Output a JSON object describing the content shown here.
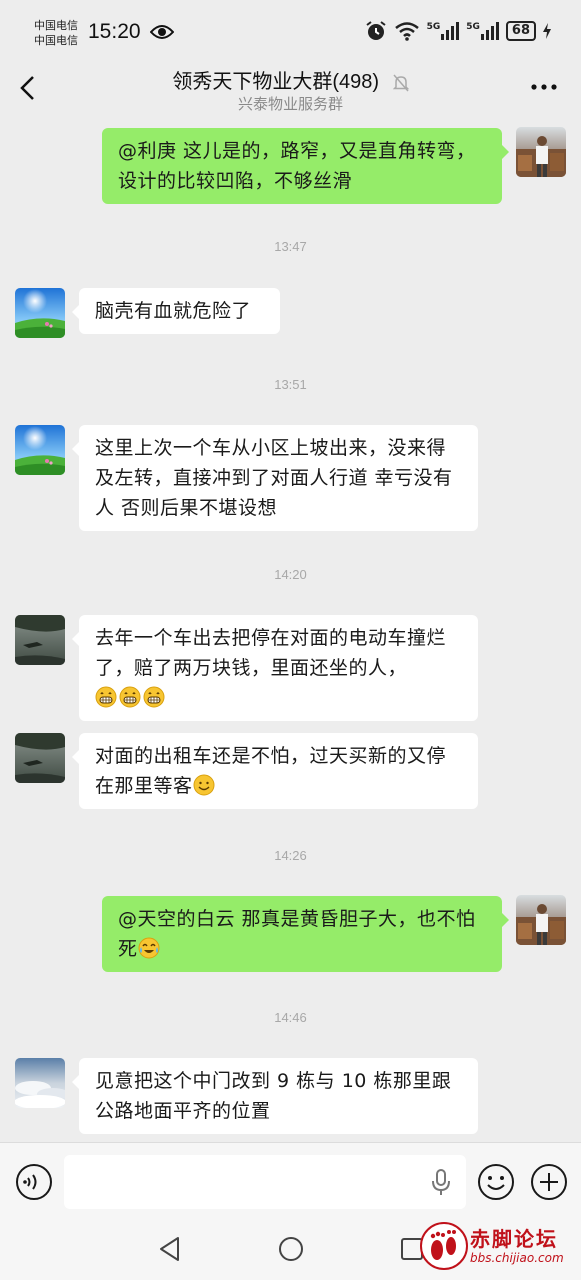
{
  "status_bar": {
    "carrier1": "中国电信",
    "carrier2": "中国电信",
    "time": "15:20",
    "signal1_label": "5G",
    "signal2_label": "5G",
    "battery": "68"
  },
  "header": {
    "title": "领秀天下物业大群(498)",
    "subtitle": "兴泰物业服务群"
  },
  "messages": [
    {
      "side": "right",
      "text": "@利庚  这儿是的，路窄，又是直角转弯，设计的比较凹陷，不够丝滑"
    },
    {
      "timestamp": "13:47"
    },
    {
      "side": "left",
      "text": "脑壳有血就危险了"
    },
    {
      "timestamp": "13:51"
    },
    {
      "side": "left",
      "text": "这里上次一个车从小区上坡出来，没来得及左转，直接冲到了对面人行道  幸亏没有人 否则后果不堪设想"
    },
    {
      "timestamp": "14:20"
    },
    {
      "side": "left",
      "text": "去年一个车出去把停在对面的电动车撞烂了，赔了两万块钱，里面还坐的人，",
      "emoji": [
        "grin-icon",
        "grin-icon",
        "grin-icon"
      ]
    },
    {
      "side": "left",
      "text": "对面的出租车还是不怕，过天买新的又停在那里等客",
      "emoji": [
        "smile-icon"
      ]
    },
    {
      "timestamp": "14:26"
    },
    {
      "side": "right",
      "text": "@天空的白云  那真是黄昏胆子大，也不怕死",
      "emoji": [
        "tears-of-joy-icon"
      ]
    },
    {
      "timestamp": "14:46"
    },
    {
      "side": "left",
      "text": "见意把这个中门改到 9 栋与 10 栋那里跟公路地面平齐的位置"
    }
  ],
  "input": {
    "value": "",
    "placeholder": ""
  },
  "watermark": {
    "title": "赤脚论坛",
    "url": "bbs.chijiao.com"
  },
  "colors": {
    "background": "#ededed",
    "bubble_self": "#95ec69",
    "bubble_other": "#ffffff",
    "timestamp": "#a8a8a8"
  }
}
